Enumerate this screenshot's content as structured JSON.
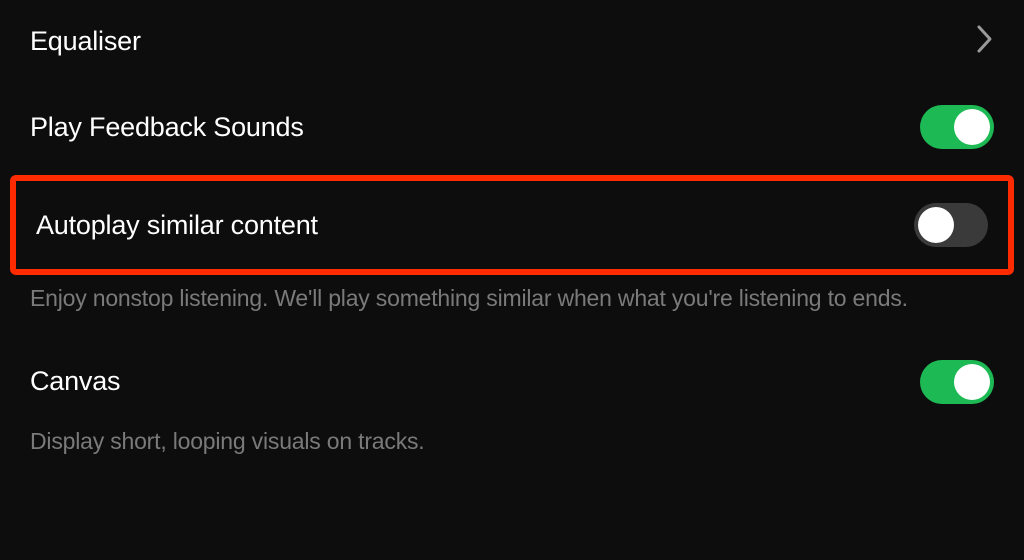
{
  "settings": {
    "equaliser": {
      "label": "Equaliser"
    },
    "feedback_sounds": {
      "label": "Play Feedback Sounds",
      "enabled": true
    },
    "autoplay": {
      "label": "Autoplay similar content",
      "enabled": false,
      "description": "Enjoy nonstop listening. We'll play something similar when what you're listening to ends."
    },
    "canvas": {
      "label": "Canvas",
      "enabled": true,
      "description": "Display short, looping visuals on tracks."
    }
  },
  "colors": {
    "accent": "#1db954",
    "highlight": "#ff2b00"
  }
}
